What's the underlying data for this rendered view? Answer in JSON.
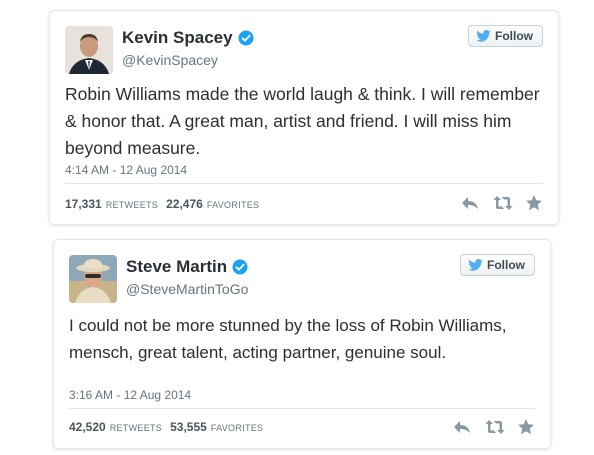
{
  "colors": {
    "verified_blue": "#1da1f2",
    "twitter_blue": "#55acee",
    "action_gray": "#8899a6",
    "text_dark": "#292f33",
    "text_muted": "#66757f"
  },
  "follow_label": "Follow",
  "tweets": [
    {
      "name": "Kevin Spacey",
      "handle": "@KevinSpacey",
      "verified": true,
      "text": "Robin Williams made the world laugh & think. I will remember & honor that. A great man, artist and friend. I will miss him beyond measure.",
      "timestamp": "4:14 AM - 12 Aug 2014",
      "retweets": "17,331",
      "retweets_label": "RETWEETS",
      "favorites": "22,476",
      "favorites_label": "FAVORITES"
    },
    {
      "name": "Steve Martin",
      "handle": "@SteveMartinToGo",
      "verified": true,
      "text": "I could not be more stunned by the loss of Robin Williams, mensch, great talent, acting partner, genuine soul.",
      "timestamp": "3:16 AM - 12 Aug 2014",
      "retweets": "42,520",
      "retweets_label": "RETWEETS",
      "favorites": "53,555",
      "favorites_label": "FAVORITES"
    }
  ],
  "icons": {
    "reply": "reply-icon",
    "retweet": "retweet-icon",
    "favorite": "star-icon",
    "verified": "verified-badge-icon",
    "bird": "twitter-bird-icon"
  }
}
